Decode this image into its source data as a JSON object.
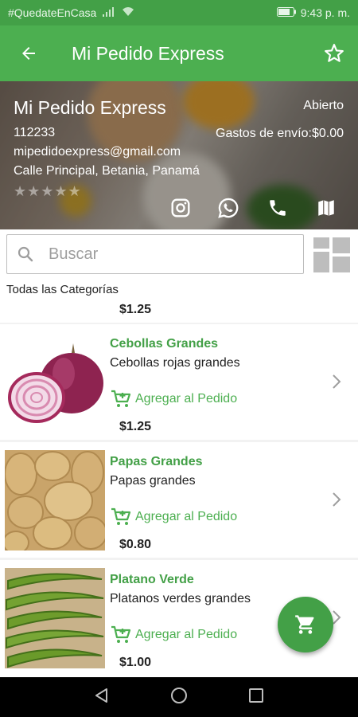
{
  "status_bar": {
    "carrier_text": "#QuedateEnCasa",
    "time": "9:43 p. m."
  },
  "app_bar": {
    "title": "Mi Pedido Express",
    "back_icon": "arrow-back-icon",
    "favorite_icon": "star-outline-icon"
  },
  "shop": {
    "name": "Mi Pedido Express",
    "status": "Abierto",
    "code": "112233",
    "shipping": "Gastos de envío:$0.00",
    "email": "mipedidoexpress@gmail.com",
    "address": "Calle Principal, Betania, Panamá",
    "rating": "★★★★★",
    "rating_value": 0,
    "social_icons": [
      "instagram-icon",
      "whatsapp-icon",
      "phone-icon",
      "map-icon"
    ]
  },
  "search": {
    "placeholder": "Buscar",
    "value": ""
  },
  "category": {
    "label": "Todas las Categorías"
  },
  "products": [
    {
      "name": "",
      "description": "",
      "add_label": "",
      "price": "$1.25"
    },
    {
      "name": "Cebollas Grandes",
      "description": "Cebollas rojas grandes",
      "add_label": "Agregar al Pedido",
      "price": "$1.25"
    },
    {
      "name": "Papas Grandes",
      "description": "Papas grandes",
      "add_label": "Agregar al Pedido",
      "price": "$0.80"
    },
    {
      "name": "Platano Verde",
      "description": "Platanos verdes grandes",
      "add_label": "Agregar al Pedido",
      "price": "$1.00"
    }
  ],
  "colors": {
    "primary": "#4caf50",
    "primary_dark": "#43a047",
    "accent_text": "#43a047"
  }
}
